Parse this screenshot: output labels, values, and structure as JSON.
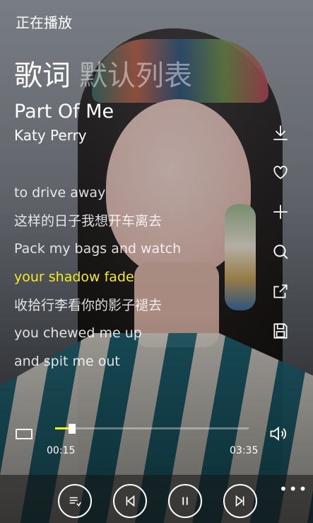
{
  "header": {
    "title": "正在播放"
  },
  "tabs": [
    {
      "label": "歌词"
    },
    {
      "label": "默认列表"
    }
  ],
  "song": {
    "title": "Part Of Me",
    "artist": "Katy Perry"
  },
  "lyrics": [
    {
      "text": "to drive away"
    },
    {
      "text": "这样的日子我想开车离去"
    },
    {
      "text": "Pack my bags and watch"
    },
    {
      "text": "your shadow fade"
    },
    {
      "text": "收拾行李看你的影子褪去"
    },
    {
      "text": "you chewed me up"
    },
    {
      "text": "and spit me out"
    }
  ],
  "active_lyric_index": 3,
  "playback": {
    "current": "00:15",
    "total": "03:35",
    "progress": 0.07
  },
  "colors": {
    "accent": "#f4ec21",
    "text": "#ffffff"
  },
  "icons": [
    "download-icon",
    "heart-icon",
    "add-icon",
    "search-icon",
    "share-icon",
    "save-icon",
    "repeat-icon",
    "volume-icon",
    "playlist-icon",
    "previous-icon",
    "pause-icon",
    "next-icon",
    "more-icon"
  ]
}
